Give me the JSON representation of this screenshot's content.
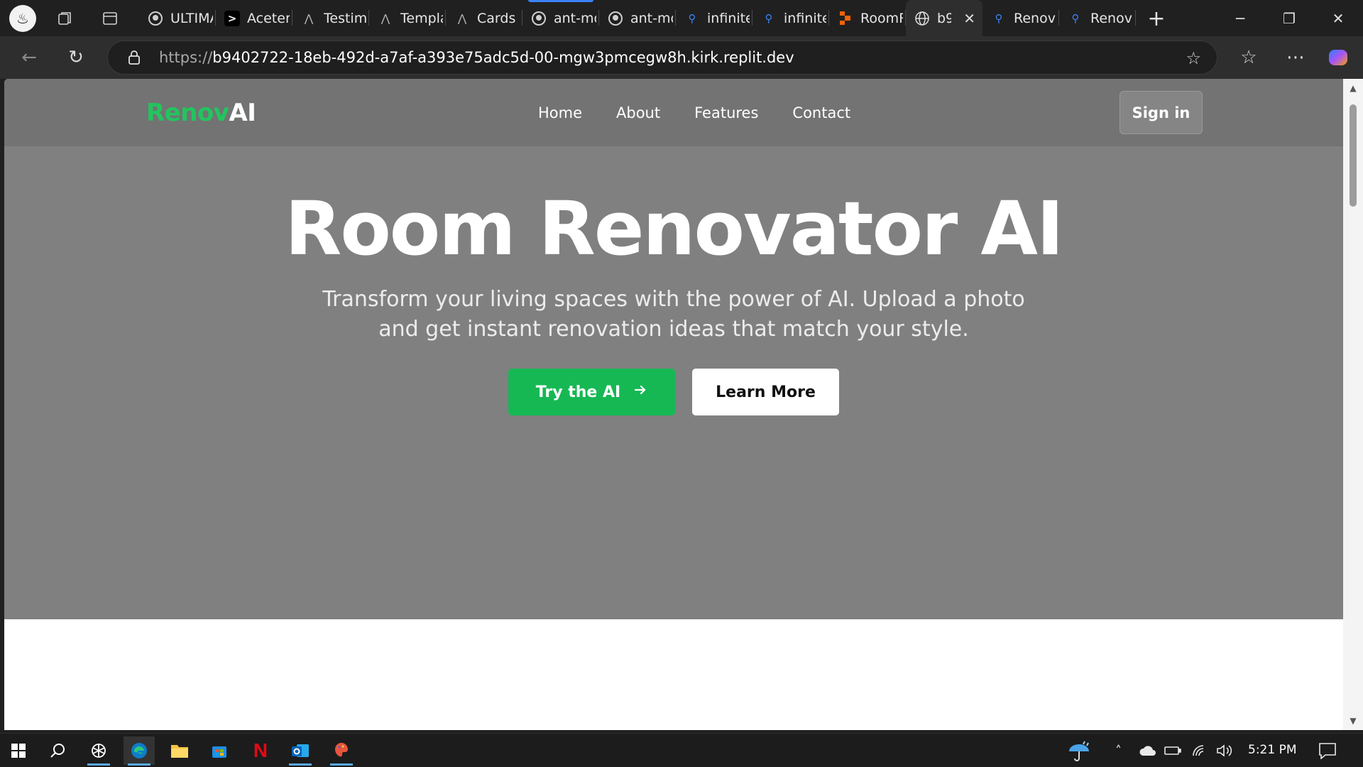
{
  "browser": {
    "tabs": [
      {
        "title": "ULTIMA",
        "icon": "github-icon",
        "active": false
      },
      {
        "title": "Aceternity",
        "icon": "aceternity-icon",
        "active": false
      },
      {
        "title": "Testimonials",
        "icon": "shadcn-icon",
        "active": false
      },
      {
        "title": "Templates",
        "icon": "shadcn-icon",
        "active": false
      },
      {
        "title": "Cards",
        "icon": "shadcn-icon",
        "active": false
      },
      {
        "title": "ant-mo",
        "icon": "github-icon",
        "active": false
      },
      {
        "title": "ant-mo",
        "icon": "github-icon",
        "active": false
      },
      {
        "title": "infinite",
        "icon": "search-icon",
        "active": false
      },
      {
        "title": "infinite",
        "icon": "search-icon",
        "active": false
      },
      {
        "title": "RoomR",
        "icon": "replit-icon",
        "active": false
      },
      {
        "title": "b9",
        "icon": "globe-icon",
        "active": true
      },
      {
        "title": "Renova",
        "icon": "search-icon",
        "active": false
      },
      {
        "title": "Renova",
        "icon": "search-icon",
        "active": false
      }
    ],
    "url_scheme": "https://",
    "url_rest": "b9402722-18eb-492d-a7af-a393e75adc5d-00-mgw3pmcegw8h.kirk.replit.dev"
  },
  "site": {
    "logo_part1": "Renov",
    "logo_part2": "AI",
    "nav": [
      "Home",
      "About",
      "Features",
      "Contact"
    ],
    "signin": "Sign in",
    "hero_title": "Room Renovator AI",
    "hero_subtitle": "Transform your living spaces with the power of AI. Upload a photo and get instant renovation ideas that match your style.",
    "btn_try": "Try the AI",
    "btn_learn": "Learn More"
  },
  "colors": {
    "brand_green": "#22c55e",
    "button_green": "#16b854",
    "hero_bg": "#808080"
  },
  "taskbar": {
    "time": "5:21 PM"
  }
}
